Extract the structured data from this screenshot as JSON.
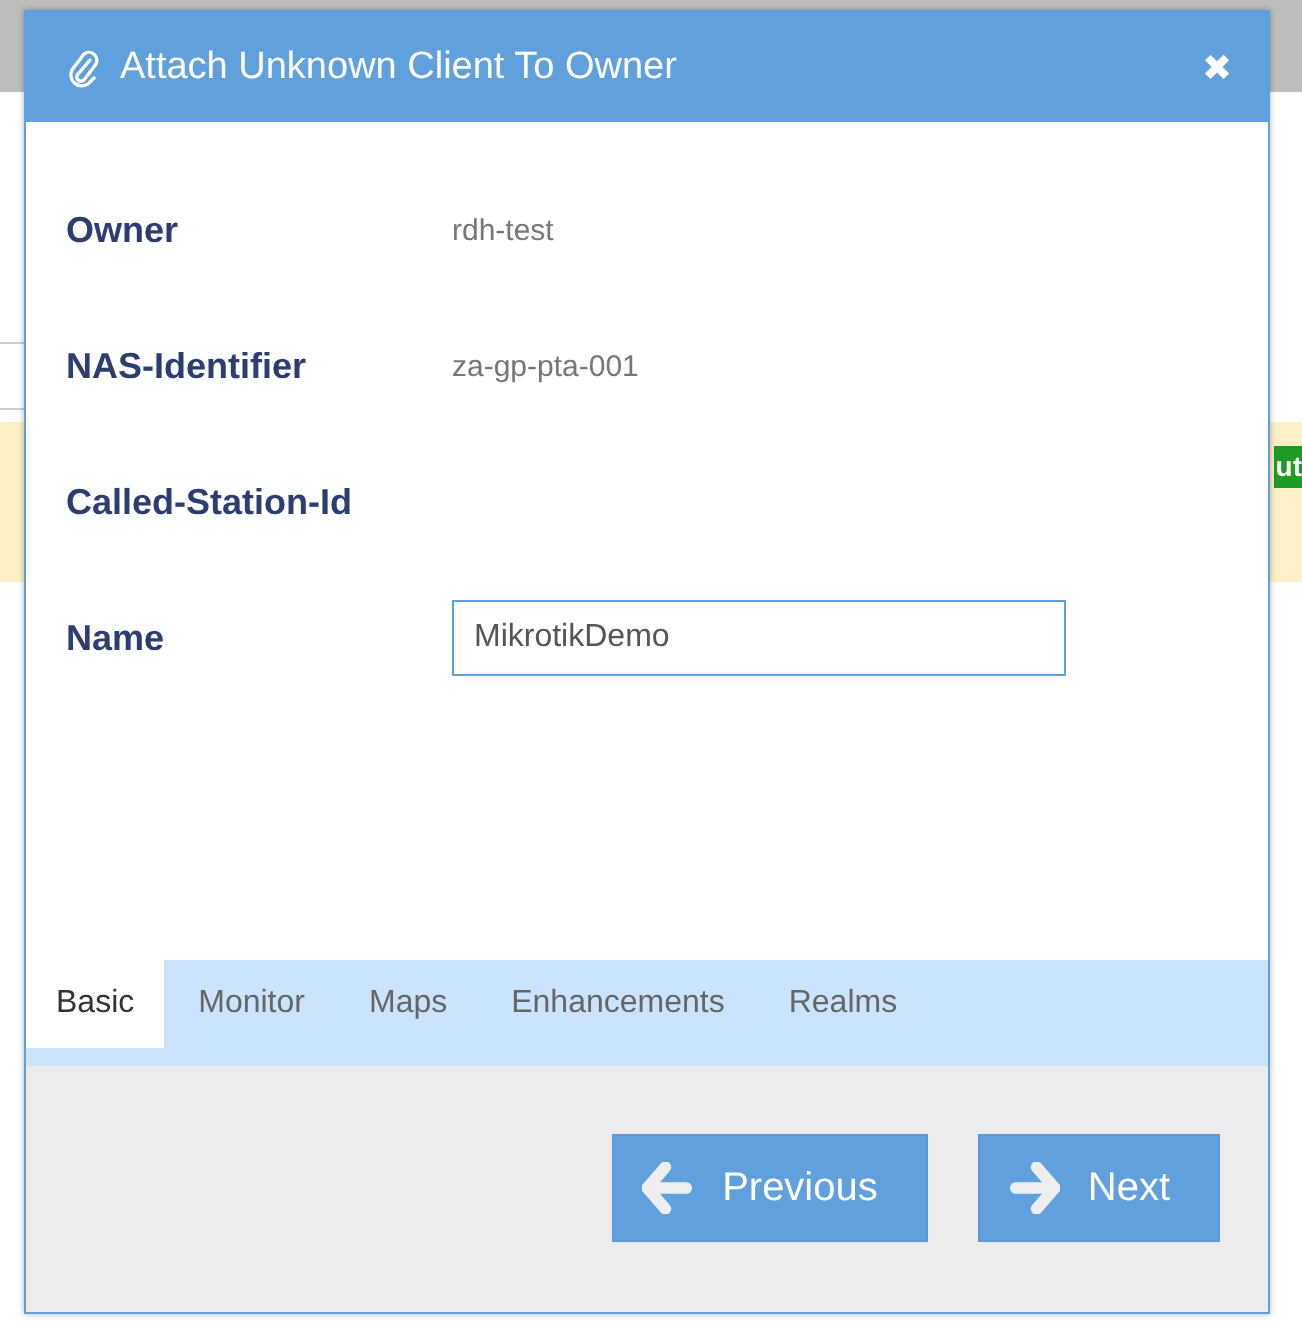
{
  "background": {
    "badge": "ut"
  },
  "dialog": {
    "title": "Attach Unknown Client To Owner",
    "close": "✖",
    "fields": [
      {
        "label": "Owner",
        "kind": "text",
        "value": "rdh-test"
      },
      {
        "label": "NAS-Identifier",
        "kind": "text",
        "value": "za-gp-pta-001"
      },
      {
        "label": "Called-Station-Id",
        "kind": "text"
      },
      {
        "label": "Name",
        "kind": "input",
        "value": "MikrotikDemo"
      }
    ],
    "tabs": [
      {
        "label": "Basic",
        "selected": true
      },
      {
        "label": "Monitor",
        "selected": false
      },
      {
        "label": "Maps",
        "selected": false
      },
      {
        "label": "Enhancements",
        "selected": false
      },
      {
        "label": "Realms",
        "selected": false
      }
    ],
    "buttons": [
      {
        "label": "Previous",
        "kind": "back"
      },
      {
        "label": "Next",
        "kind": "forward"
      }
    ]
  }
}
